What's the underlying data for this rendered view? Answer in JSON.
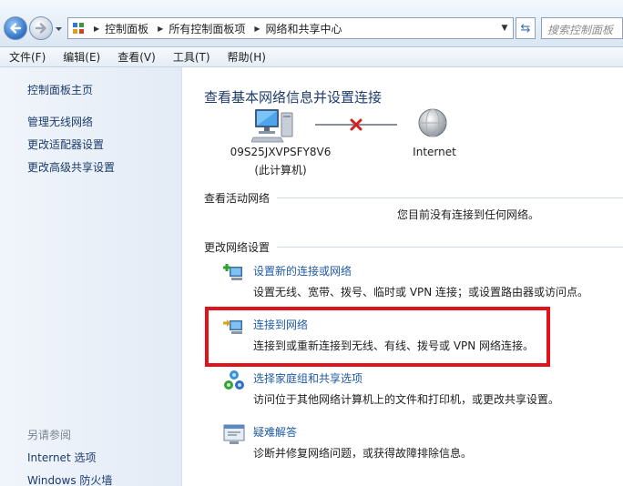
{
  "address_bar": {
    "breadcrumbs": [
      "控制面板",
      "所有控制面板项",
      "网络和共享中心"
    ],
    "search_placeholder": "搜索控制面板"
  },
  "menu": [
    "文件(F)",
    "编辑(E)",
    "查看(V)",
    "工具(T)",
    "帮助(H)"
  ],
  "sidebar": {
    "home": "控制面板主页",
    "links": [
      "管理无线网络",
      "更改适配器设置",
      "更改高级共享设置"
    ],
    "see_also_title": "另请参阅",
    "see_also": [
      "Internet 选项",
      "Windows 防火墙"
    ]
  },
  "main": {
    "title": "查看基本网络信息并设置连接",
    "computer_name": "09S25JXVPSFY8V6",
    "computer_sub": "(此计算机)",
    "internet_label": "Internet",
    "active_networks_title": "查看活动网络",
    "active_networks_status": "您目前没有连接到任何网络。",
    "change_settings_title": "更改网络设置",
    "tasks": [
      {
        "icon": "new-connection-icon",
        "link": "设置新的连接或网络",
        "desc": "设置无线、宽带、拨号、临时或 VPN 连接；或设置路由器或访问点。"
      },
      {
        "icon": "connect-network-icon",
        "link": "连接到网络",
        "desc": "连接到或重新连接到无线、有线、拨号或 VPN 网络连接。"
      },
      {
        "icon": "homegroup-icon",
        "link": "选择家庭组和共享选项",
        "desc": "访问位于其他网络计算机上的文件和打印机，或更改共享设置。"
      },
      {
        "icon": "troubleshoot-icon",
        "link": "疑难解答",
        "desc": "诊断并修复网络问题，或获得故障排除信息。"
      }
    ]
  },
  "colors": {
    "link": "#1f5aa6",
    "highlight": "#e0121b",
    "title": "#1e3c6e"
  }
}
